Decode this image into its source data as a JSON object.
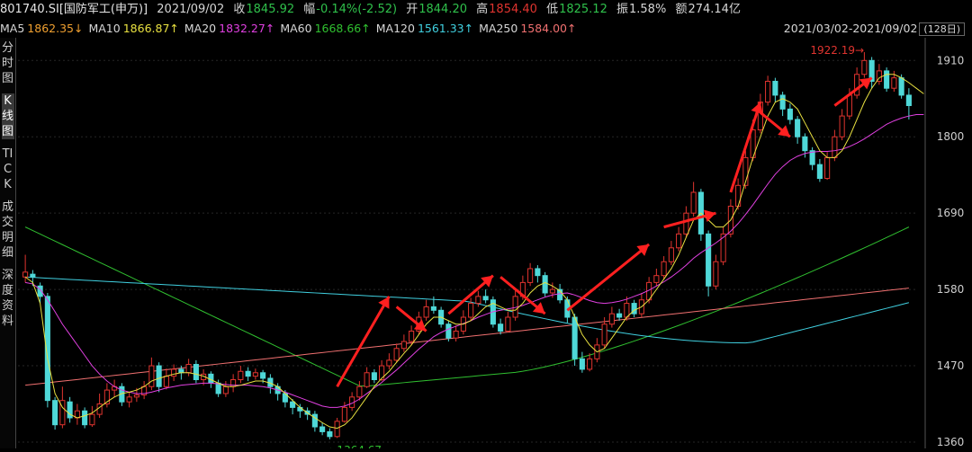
{
  "header": {
    "code": "801740.SI[国防军工(申万)]",
    "date": "2021/09/02",
    "close_label": "收",
    "close_value": "1845.92",
    "change_label": "幅",
    "change_value": "-0.14%(-2.52)",
    "open_label": "开",
    "open_value": "1844.20",
    "high_label": "高",
    "high_value": "1854.40",
    "low_label": "低",
    "low_value": "1825.12",
    "amp_label": "振",
    "amp_value": "1.58%",
    "amount_label": "额",
    "amount_value": "274.14亿"
  },
  "ma_bar": [
    {
      "label": "MA5",
      "value": "1862.35↓",
      "color": "#f0a030"
    },
    {
      "label": "MA10",
      "value": "1866.87↑",
      "color": "#e8e040"
    },
    {
      "label": "MA20",
      "value": "1832.27↑",
      "color": "#e040e0"
    },
    {
      "label": "MA60",
      "value": "1668.66↑",
      "color": "#30c030"
    },
    {
      "label": "MA120",
      "value": "1561.33↑",
      "color": "#40d0e0"
    },
    {
      "label": "MA250",
      "value": "1584.00↑",
      "color": "#f07070"
    }
  ],
  "range_text": "2021/03/02-2021/09/02",
  "range_box": "(128日)",
  "sidebar": [
    {
      "name": "sidebar-fenshi",
      "label": "分时图",
      "active": false
    },
    {
      "name": "sidebar-kline",
      "label": "K线图",
      "active": true
    },
    {
      "name": "sidebar-tick",
      "label": "TICK",
      "active": false
    },
    {
      "name": "sidebar-deals",
      "label": "成交明细",
      "active": false
    },
    {
      "name": "sidebar-depth",
      "label": "深度资料",
      "active": false
    }
  ],
  "colors": {
    "up": "#e0342f",
    "down": "#4fd8d8",
    "arrow": "#ff2020"
  },
  "chart_data": {
    "type": "candlestick",
    "yticks": [
      1360,
      1470,
      1580,
      1690,
      1800,
      1910
    ],
    "ylim": [
      1360,
      1935
    ],
    "max_label": "1922.19",
    "min_label": "1364.67",
    "candles": [
      [
        1598,
        1605,
        1630,
        1590
      ],
      [
        1602,
        1598,
        1608,
        1585
      ],
      [
        1585,
        1570,
        1590,
        1560
      ],
      [
        1570,
        1420,
        1575,
        1410
      ],
      [
        1420,
        1385,
        1425,
        1378
      ],
      [
        1385,
        1420,
        1440,
        1380
      ],
      [
        1418,
        1395,
        1425,
        1388
      ],
      [
        1395,
        1405,
        1415,
        1385
      ],
      [
        1405,
        1385,
        1410,
        1380
      ],
      [
        1385,
        1400,
        1412,
        1382
      ],
      [
        1400,
        1415,
        1430,
        1395
      ],
      [
        1415,
        1435,
        1445,
        1410
      ],
      [
        1435,
        1440,
        1450,
        1425
      ],
      [
        1440,
        1418,
        1445,
        1412
      ],
      [
        1418,
        1425,
        1432,
        1410
      ],
      [
        1425,
        1428,
        1438,
        1418
      ],
      [
        1428,
        1440,
        1448,
        1422
      ],
      [
        1440,
        1470,
        1482,
        1435
      ],
      [
        1470,
        1440,
        1475,
        1432
      ],
      [
        1440,
        1455,
        1466,
        1436
      ],
      [
        1455,
        1465,
        1472,
        1448
      ],
      [
        1465,
        1460,
        1470,
        1450
      ],
      [
        1460,
        1472,
        1480,
        1455
      ],
      [
        1472,
        1450,
        1478,
        1445
      ],
      [
        1450,
        1458,
        1465,
        1442
      ],
      [
        1458,
        1445,
        1462,
        1438
      ],
      [
        1445,
        1430,
        1450,
        1425
      ],
      [
        1430,
        1440,
        1448,
        1425
      ],
      [
        1440,
        1450,
        1458,
        1432
      ],
      [
        1450,
        1462,
        1470,
        1445
      ],
      [
        1462,
        1455,
        1468,
        1448
      ],
      [
        1455,
        1460,
        1466,
        1450
      ],
      [
        1460,
        1452,
        1464,
        1445
      ],
      [
        1452,
        1440,
        1458,
        1430
      ],
      [
        1440,
        1430,
        1445,
        1420
      ],
      [
        1430,
        1418,
        1435,
        1410
      ],
      [
        1418,
        1410,
        1422,
        1400
      ],
      [
        1410,
        1405,
        1415,
        1395
      ],
      [
        1405,
        1400,
        1410,
        1392
      ],
      [
        1400,
        1382,
        1405,
        1375
      ],
      [
        1382,
        1375,
        1388,
        1370
      ],
      [
        1375,
        1368,
        1380,
        1364
      ],
      [
        1368,
        1390,
        1395,
        1366
      ],
      [
        1390,
        1410,
        1418,
        1388
      ],
      [
        1410,
        1425,
        1432,
        1405
      ],
      [
        1425,
        1440,
        1448,
        1420
      ],
      [
        1440,
        1460,
        1468,
        1438
      ],
      [
        1460,
        1450,
        1465,
        1445
      ],
      [
        1450,
        1470,
        1478,
        1448
      ],
      [
        1470,
        1478,
        1488,
        1465
      ],
      [
        1478,
        1495,
        1502,
        1475
      ],
      [
        1495,
        1505,
        1515,
        1490
      ],
      [
        1505,
        1520,
        1528,
        1500
      ],
      [
        1520,
        1540,
        1548,
        1515
      ],
      [
        1540,
        1555,
        1565,
        1535
      ],
      [
        1555,
        1550,
        1570,
        1545
      ],
      [
        1550,
        1530,
        1555,
        1525
      ],
      [
        1530,
        1510,
        1535,
        1505
      ],
      [
        1510,
        1520,
        1528,
        1505
      ],
      [
        1520,
        1540,
        1550,
        1515
      ],
      [
        1540,
        1560,
        1568,
        1535
      ],
      [
        1560,
        1570,
        1578,
        1555
      ],
      [
        1570,
        1565,
        1580,
        1560
      ],
      [
        1565,
        1530,
        1570,
        1525
      ],
      [
        1530,
        1520,
        1538,
        1515
      ],
      [
        1520,
        1540,
        1548,
        1518
      ],
      [
        1540,
        1570,
        1580,
        1535
      ],
      [
        1570,
        1590,
        1600,
        1565
      ],
      [
        1590,
        1610,
        1618,
        1585
      ],
      [
        1610,
        1600,
        1615,
        1590
      ],
      [
        1600,
        1575,
        1605,
        1570
      ],
      [
        1575,
        1580,
        1590,
        1568
      ],
      [
        1580,
        1565,
        1588,
        1560
      ],
      [
        1565,
        1540,
        1570,
        1532
      ],
      [
        1540,
        1480,
        1545,
        1470
      ],
      [
        1480,
        1465,
        1490,
        1460
      ],
      [
        1465,
        1480,
        1488,
        1462
      ],
      [
        1480,
        1500,
        1510,
        1475
      ],
      [
        1500,
        1530,
        1540,
        1495
      ],
      [
        1530,
        1545,
        1555,
        1525
      ],
      [
        1545,
        1540,
        1552,
        1535
      ],
      [
        1540,
        1560,
        1570,
        1535
      ],
      [
        1560,
        1545,
        1565,
        1540
      ],
      [
        1545,
        1565,
        1575,
        1540
      ],
      [
        1565,
        1590,
        1598,
        1560
      ],
      [
        1590,
        1600,
        1610,
        1585
      ],
      [
        1600,
        1620,
        1628,
        1595
      ],
      [
        1620,
        1640,
        1650,
        1615
      ],
      [
        1640,
        1660,
        1670,
        1635
      ],
      [
        1660,
        1690,
        1700,
        1655
      ],
      [
        1690,
        1720,
        1735,
        1685
      ],
      [
        1720,
        1660,
        1725,
        1650
      ],
      [
        1660,
        1585,
        1665,
        1570
      ],
      [
        1585,
        1620,
        1630,
        1580
      ],
      [
        1620,
        1660,
        1670,
        1615
      ],
      [
        1660,
        1700,
        1710,
        1655
      ],
      [
        1700,
        1730,
        1740,
        1695
      ],
      [
        1730,
        1770,
        1780,
        1725
      ],
      [
        1770,
        1810,
        1825,
        1765
      ],
      [
        1810,
        1850,
        1862,
        1805
      ],
      [
        1850,
        1880,
        1888,
        1845
      ],
      [
        1880,
        1860,
        1885,
        1850
      ],
      [
        1860,
        1840,
        1865,
        1830
      ],
      [
        1840,
        1825,
        1848,
        1818
      ],
      [
        1825,
        1800,
        1830,
        1790
      ],
      [
        1800,
        1780,
        1805,
        1770
      ],
      [
        1780,
        1760,
        1785,
        1752
      ],
      [
        1760,
        1740,
        1768,
        1735
      ],
      [
        1740,
        1770,
        1778,
        1738
      ],
      [
        1770,
        1800,
        1810,
        1765
      ],
      [
        1800,
        1830,
        1840,
        1795
      ],
      [
        1830,
        1860,
        1870,
        1825
      ],
      [
        1860,
        1890,
        1900,
        1855
      ],
      [
        1890,
        1910,
        1922,
        1885
      ],
      [
        1910,
        1880,
        1915,
        1870
      ],
      [
        1880,
        1895,
        1905,
        1875
      ],
      [
        1895,
        1870,
        1900,
        1865
      ],
      [
        1870,
        1885,
        1895,
        1865
      ],
      [
        1885,
        1860,
        1890,
        1855
      ],
      [
        1860,
        1845,
        1870,
        1825
      ]
    ],
    "ma_lines": {
      "MA5": [
        1598,
        1590,
        1560,
        1480,
        1430,
        1410,
        1400,
        1395,
        1398,
        1402,
        1410,
        1418,
        1425,
        1430,
        1432,
        1435,
        1440,
        1448,
        1452,
        1455,
        1458,
        1460,
        1460,
        1458,
        1455,
        1450,
        1445,
        1440,
        1440,
        1442,
        1445,
        1448,
        1448,
        1445,
        1440,
        1430,
        1420,
        1410,
        1402,
        1395,
        1388,
        1382,
        1380,
        1385,
        1395,
        1410,
        1425,
        1440,
        1452,
        1462,
        1475,
        1488,
        1500,
        1515,
        1530,
        1540,
        1540,
        1535,
        1530,
        1530,
        1535,
        1545,
        1555,
        1560,
        1555,
        1550,
        1550,
        1560,
        1575,
        1585,
        1590,
        1585,
        1578,
        1565,
        1540,
        1515,
        1500,
        1490,
        1495,
        1510,
        1525,
        1540,
        1550,
        1555,
        1565,
        1580,
        1595,
        1610,
        1630,
        1655,
        1680,
        1690,
        1680,
        1670,
        1670,
        1680,
        1700,
        1735,
        1770,
        1800,
        1830,
        1850,
        1855,
        1850,
        1840,
        1820,
        1800,
        1780,
        1770,
        1770,
        1780,
        1800,
        1825,
        1850,
        1870,
        1885,
        1890,
        1890,
        1885,
        1878,
        1870,
        1862
      ],
      "MA20": [
        1590,
        1588,
        1580,
        1565,
        1548,
        1530,
        1515,
        1500,
        1485,
        1470,
        1458,
        1448,
        1440,
        1435,
        1432,
        1430,
        1430,
        1432,
        1435,
        1438,
        1440,
        1442,
        1443,
        1444,
        1445,
        1445,
        1444,
        1443,
        1442,
        1442,
        1442,
        1441,
        1440,
        1438,
        1435,
        1432,
        1428,
        1424,
        1420,
        1416,
        1412,
        1410,
        1410,
        1412,
        1416,
        1422,
        1430,
        1438,
        1446,
        1455,
        1464,
        1474,
        1484,
        1494,
        1503,
        1512,
        1518,
        1523,
        1527,
        1531,
        1535,
        1540,
        1544,
        1548,
        1550,
        1552,
        1554,
        1557,
        1561,
        1565,
        1569,
        1572,
        1574,
        1575,
        1572,
        1568,
        1564,
        1561,
        1560,
        1561,
        1563,
        1566,
        1570,
        1574,
        1579,
        1585,
        1591,
        1598,
        1606,
        1615,
        1625,
        1633,
        1640,
        1647,
        1655,
        1664,
        1675,
        1688,
        1702,
        1717,
        1732,
        1746,
        1757,
        1766,
        1772,
        1776,
        1778,
        1779,
        1779,
        1780,
        1782,
        1786,
        1791,
        1797,
        1804,
        1811,
        1818,
        1823,
        1827,
        1830,
        1832,
        1832
      ]
    }
  }
}
